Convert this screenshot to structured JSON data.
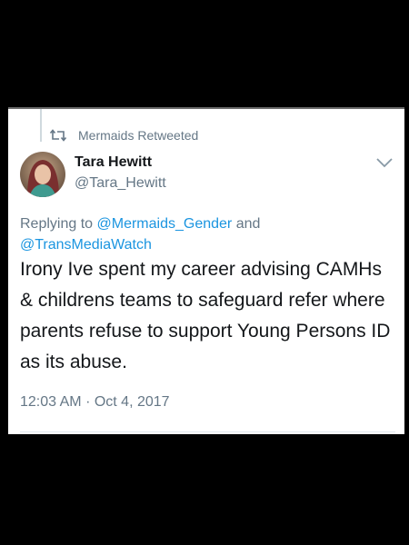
{
  "retweet": {
    "label": "Mermaids Retweeted",
    "icon": "retweet-icon"
  },
  "author": {
    "name": "Tara Hewitt",
    "handle": "@Tara_Hewitt"
  },
  "reply": {
    "prefix": "Replying to",
    "mention_1": "@Mermaids_Gender",
    "conjunction": "and",
    "mention_2": "@TransMediaWatch"
  },
  "tweet": {
    "text": "Irony Ive spent my career advising CAMHs & childrens teams to safeguard refer where parents refuse to support Young Persons ID as its abuse."
  },
  "meta": {
    "time": "12:03 AM",
    "separator": "·",
    "date": "Oct 4, 2017"
  },
  "colors": {
    "link": "#1b95e0",
    "secondary_text": "#657786",
    "primary_text": "#14171a",
    "background": "#000000",
    "card": "#ffffff"
  }
}
